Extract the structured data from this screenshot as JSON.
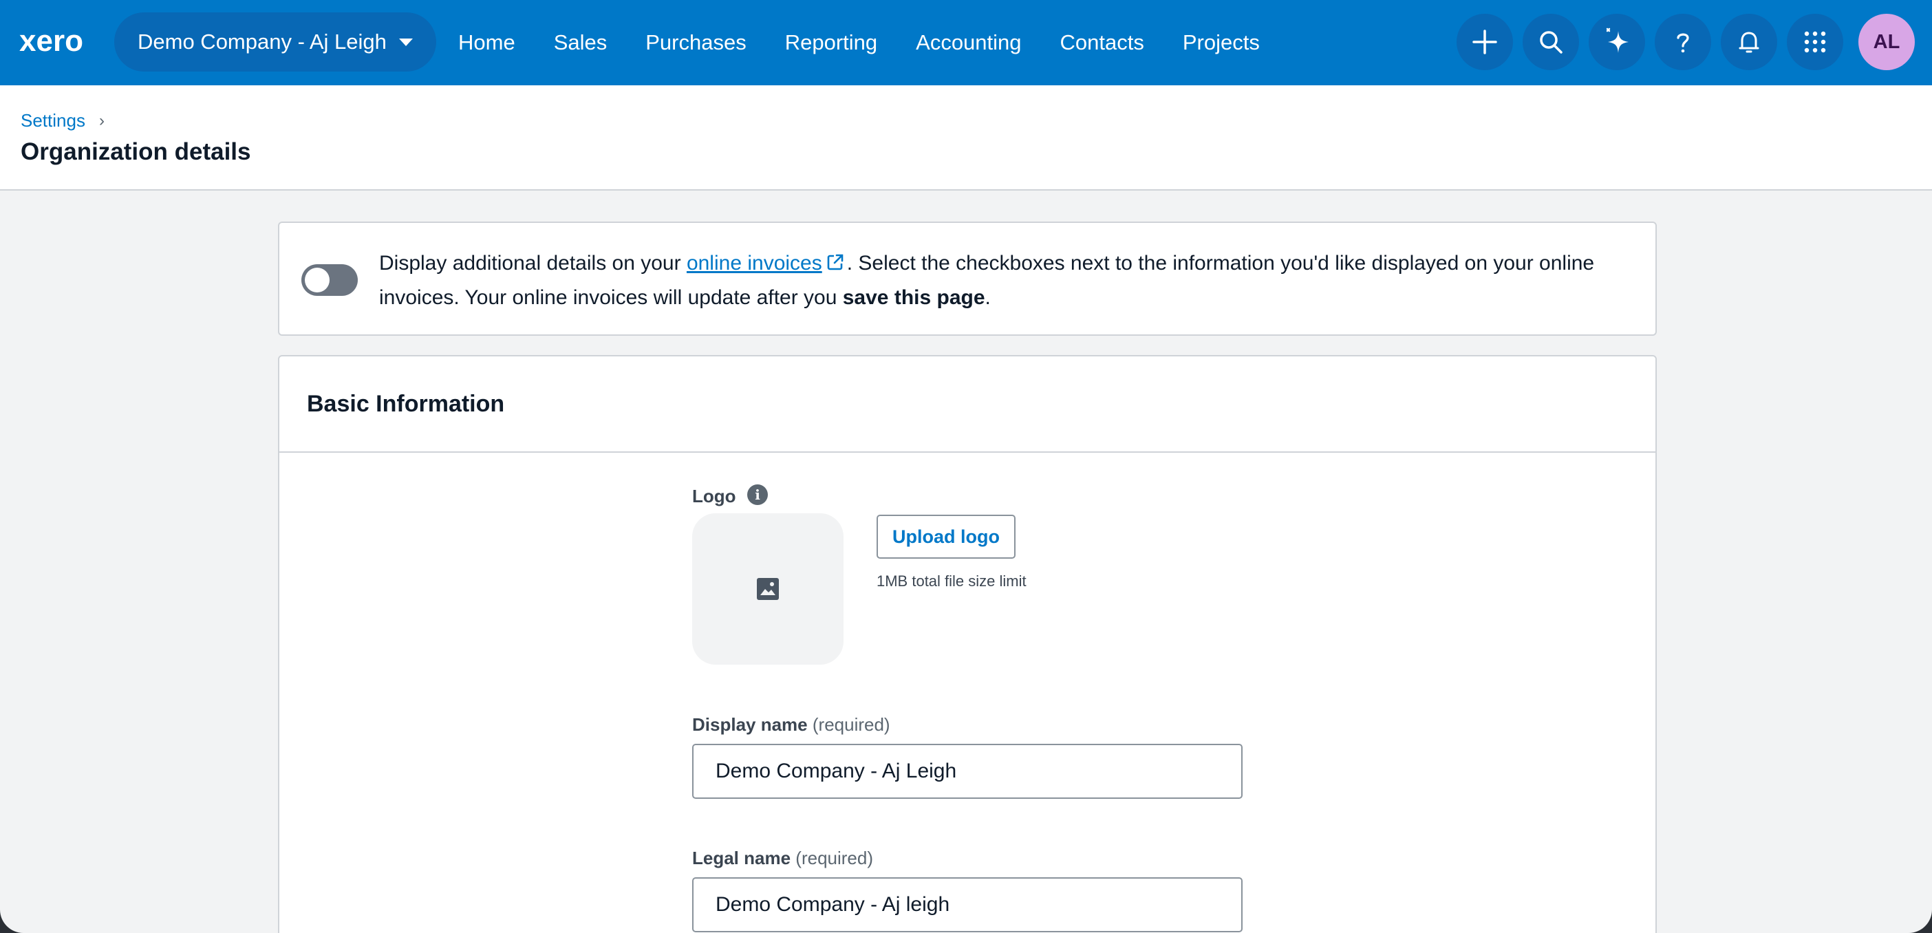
{
  "nav": {
    "brand": "xero",
    "org_name": "Demo Company - Aj Leigh",
    "links": [
      "Home",
      "Sales",
      "Purchases",
      "Reporting",
      "Accounting",
      "Contacts",
      "Projects"
    ],
    "icons": [
      "plus-icon",
      "search-icon",
      "sparkle-icon",
      "help-icon",
      "bell-icon",
      "apps-grid-icon"
    ],
    "avatar_initials": "AL"
  },
  "header": {
    "breadcrumb": "Settings",
    "title": "Organization details"
  },
  "banner": {
    "text_before": "Display additional details on your ",
    "link": "online invoices",
    "text_middle": ". Select the checkboxes next to the information you'd like displayed on your online invoices. Your online invoices will update after you ",
    "bold": "save this page",
    "text_after": ".",
    "toggle_on": false
  },
  "basic_info": {
    "title": "Basic Information",
    "logo_label": "Logo",
    "upload_button": "Upload logo",
    "upload_hint": "1MB total file size limit",
    "display_name_label": "Display name",
    "display_name_required": "(required)",
    "display_name_value": "Demo Company - Aj Leigh",
    "legal_name_label": "Legal name",
    "legal_name_required": "(required)",
    "legal_name_value": "Demo Company - Aj leigh"
  },
  "colors": {
    "brand_blue": "#0078c8",
    "nav_pill": "#0868b5",
    "avatar_bg": "#d8a6e6",
    "page_bg": "#f2f3f4"
  }
}
